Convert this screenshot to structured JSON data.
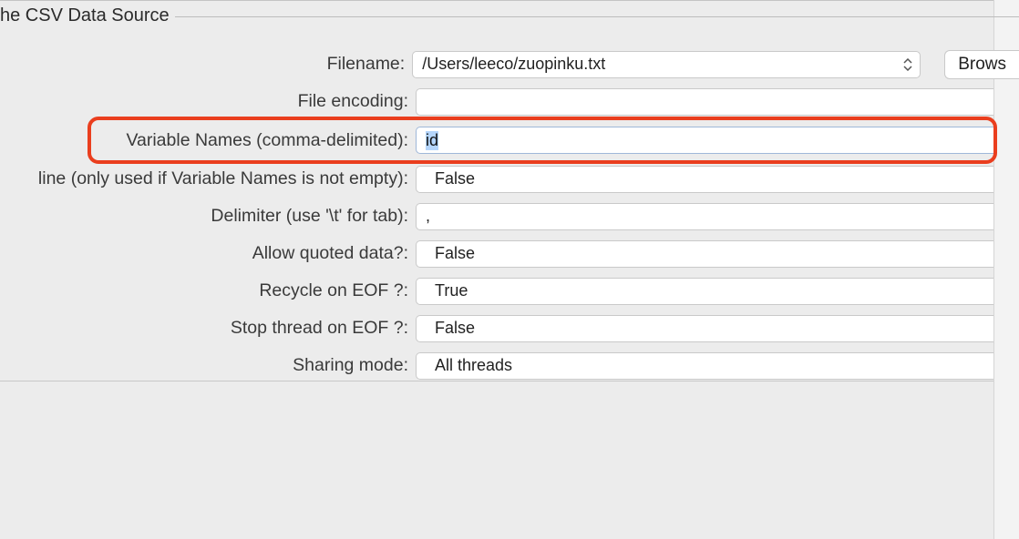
{
  "section": {
    "legend": "he CSV Data Source"
  },
  "labels": {
    "filename": "Filename:",
    "file_encoding": "File encoding:",
    "variable_names": "Variable Names (comma-delimited):",
    "ignore_first_line": "line (only used if Variable Names is not empty):",
    "delimiter": "Delimiter (use '\\t' for tab):",
    "allow_quoted": "Allow quoted data?:",
    "recycle_eof": "Recycle on EOF ?:",
    "stop_thread_eof": "Stop thread on EOF ?:",
    "sharing_mode": "Sharing mode:"
  },
  "values": {
    "filename": "/Users/leeco/zuopinku.txt",
    "file_encoding": "",
    "variable_names": "id",
    "ignore_first_line": "False",
    "delimiter": ",",
    "allow_quoted": "False",
    "recycle_eof": "True",
    "stop_thread_eof": "False",
    "sharing_mode": "All threads"
  },
  "buttons": {
    "browse": "Brows"
  }
}
